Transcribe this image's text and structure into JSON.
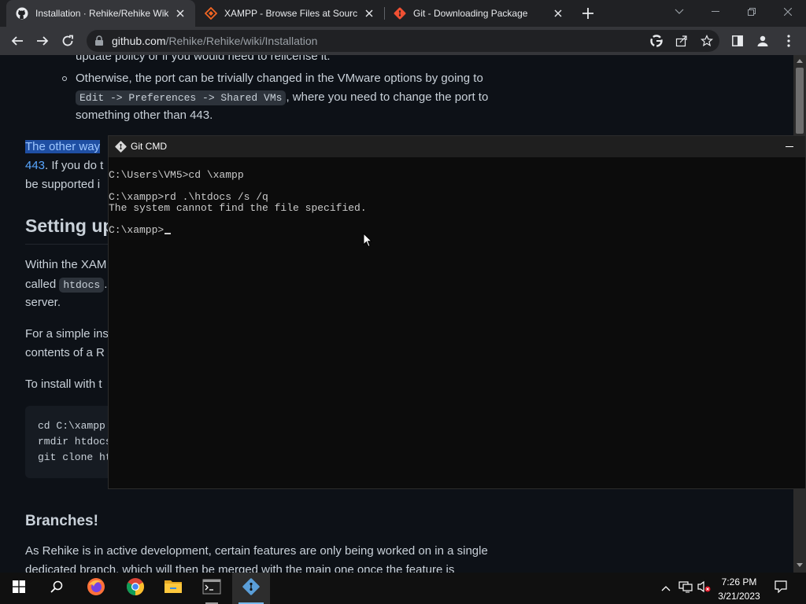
{
  "browser": {
    "tabs": [
      {
        "title": "Installation · Rehike/Rehike Wiki ·",
        "active": true
      },
      {
        "title": "XAMPP - Browse Files at SourceF",
        "active": false
      },
      {
        "title": "Git - Downloading Package",
        "active": false
      }
    ],
    "address": {
      "host": "github.com",
      "path": "/Rehike/Rehike/wiki/Installation"
    }
  },
  "page": {
    "top_fragment": "update policy or if you would need to relicense it.",
    "bullet_line1": "Otherwise, the port can be trivially changed in the VMware options by going to",
    "bullet_code": "Edit -> Preferences -> Shared VMs",
    "bullet_line2_rest": ", where you need to change the port to",
    "bullet_line3": "something other than 443.",
    "other_way_selected": "The other way",
    "port_link": "443",
    "port_rest": ". If you do t",
    "supported": "be supported i",
    "heading_setting": "Setting up",
    "within_line1": "Within the XAM",
    "called_prefix": "called",
    "called_code": "htdocs",
    "called_rest": ".",
    "server": "server.",
    "simple_line1": "For a simple ins",
    "simple_line2": "contents of a R",
    "install_with": "To install with t",
    "code_lines": [
      "cd C:\\xampp",
      "rmdir htdocs",
      "git clone ht"
    ],
    "heading_branches": "Branches!",
    "branches_line1": "As Rehike is in active development, certain features are only being worked on in a single",
    "branches_line2": "dedicated branch, which will then be merged with the main one once the feature is"
  },
  "terminal": {
    "title": "Git CMD",
    "lines": [
      "C:\\Users\\VM5>cd \\xampp",
      "",
      "C:\\xampp>rd .\\htdocs /s /q",
      "The system cannot find the file specified.",
      "",
      "C:\\xampp>"
    ]
  },
  "taskbar": {
    "apps": [
      "start-icon",
      "search-icon",
      "firefox-icon",
      "chrome-icon",
      "file-explorer-icon",
      "command-prompt-icon",
      "git-cmd-icon"
    ],
    "time": "7:26 PM",
    "date": "3/21/2023"
  },
  "colors": {
    "accent": "#58a6ff",
    "selection": "#1f4fa3",
    "git_orange": "#f05033"
  }
}
